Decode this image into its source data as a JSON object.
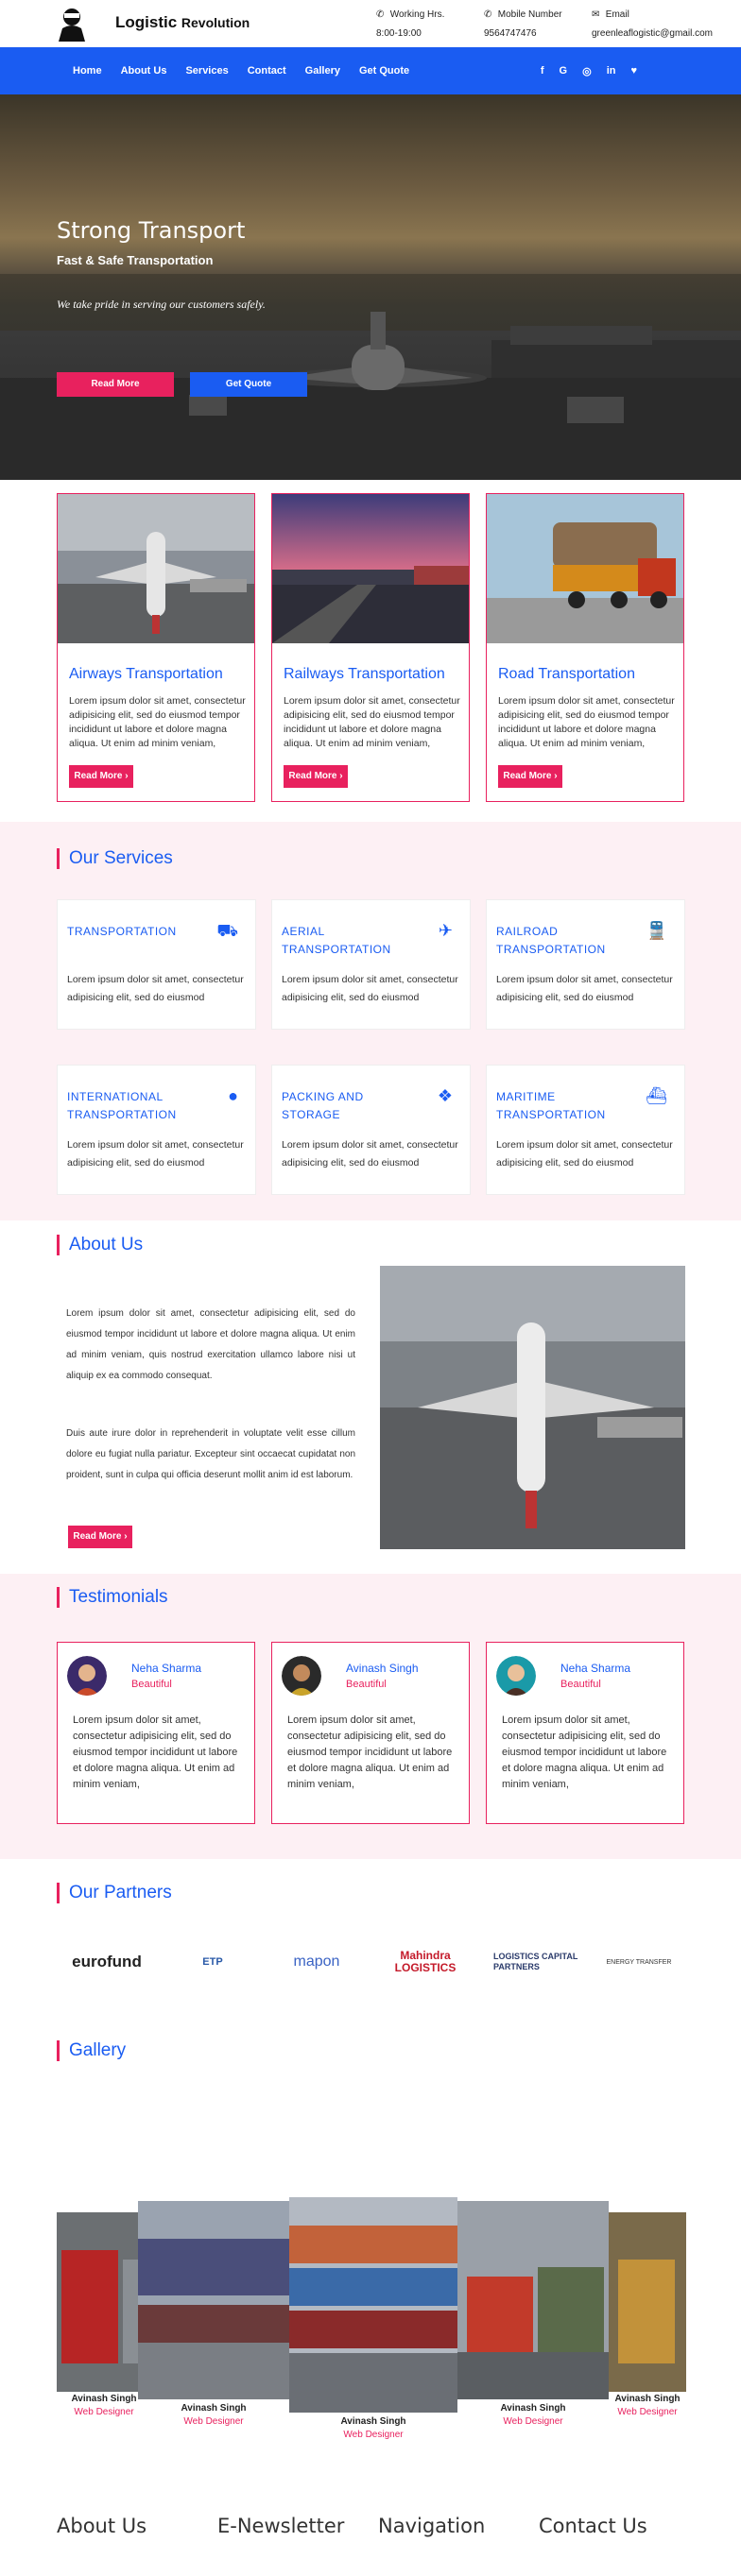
{
  "header": {
    "brand_main": "Logistic",
    "brand_sub": "Revolution",
    "working_label": "Working Hrs.",
    "working_value": "8:00-19:00",
    "mobile_label": "Mobile Number",
    "mobile_value": "9564747476",
    "email_label": "Email",
    "email_value": "greenleaflogistic@gmail.com"
  },
  "nav": {
    "items": [
      "Home",
      "About Us",
      "Services",
      "Contact",
      "Gallery",
      "Get Quote"
    ],
    "social": [
      "f",
      "G",
      "◎",
      "in",
      "♥"
    ]
  },
  "hero": {
    "title": "Strong Transport",
    "subtitle": "Fast & Safe Transportation",
    "tagline": "We take pride in serving our customers safely.",
    "btn_read": "Read More",
    "btn_quote": "Get Quote"
  },
  "transport": [
    {
      "title": "Airways Transportation",
      "text": "Lorem ipsum dolor sit amet, consectetur adipisicing elit, sed do eiusmod tempor incididunt ut labore et dolore magna aliqua. Ut enim ad minim veniam,",
      "btn": "Read More"
    },
    {
      "title": "Railways Transportation",
      "text": "Lorem ipsum dolor sit amet, consectetur adipisicing elit, sed do eiusmod tempor incididunt ut labore et dolore magna aliqua. Ut enim ad minim veniam,",
      "btn": "Read More"
    },
    {
      "title": "Road Transportation",
      "text": "Lorem ipsum dolor sit amet, consectetur adipisicing elit, sed do eiusmod tempor incididunt ut labore et dolore magna aliqua. Ut enim ad minim veniam,",
      "btn": "Read More"
    }
  ],
  "services": {
    "title": "Our Services",
    "items": [
      {
        "title": "TRANSPORTATION",
        "icon": "truck-icon",
        "text": "Lorem ipsum dolor sit amet, consectetur adipisicing elit, sed do eiusmod"
      },
      {
        "title": "AERIAL TRANSPORTATION",
        "icon": "plane-icon",
        "text": "Lorem ipsum dolor sit amet, consectetur adipisicing elit, sed do eiusmod"
      },
      {
        "title": "RAILROAD TRANSPORTATION",
        "icon": "train-icon",
        "text": "Lorem ipsum dolor sit amet, consectetur adipisicing elit, sed do eiusmod"
      },
      {
        "title": "INTERNATIONAL TRANSPORTATION",
        "icon": "globe-icon",
        "text": "Lorem ipsum dolor sit amet, consectetur adipisicing elit, sed do eiusmod"
      },
      {
        "title": "PACKING AND STORAGE",
        "icon": "dropbox-icon",
        "text": "Lorem ipsum dolor sit amet, consectetur adipisicing elit, sed do eiusmod"
      },
      {
        "title": "MARITIME TRANSPORTATION",
        "icon": "ship-icon",
        "text": "Lorem ipsum dolor sit amet, consectetur adipisicing elit, sed do eiusmod"
      }
    ]
  },
  "about": {
    "title": "About Us",
    "p1": "Lorem ipsum dolor sit amet, consectetur adipisicing elit, sed do eiusmod tempor incididunt ut labore et dolore magna aliqua. Ut enim ad minim veniam, quis nostrud exercitation ullamco labore nisi ut aliquip ex ea commodo consequat.",
    "p2": "Duis aute irure dolor in reprehenderit in voluptate velit esse cillum dolore eu fugiat nulla pariatur. Excepteur sint occaecat cupidatat non proident, sunt in culpa qui officia deserunt mollit anim id est laborum.",
    "btn": "Read More"
  },
  "testimonials": {
    "title": "Testimonials",
    "items": [
      {
        "name": "Neha Sharma",
        "role": "Beautiful",
        "text": "Lorem ipsum dolor sit amet, consectetur adipisicing elit, sed do eiusmod tempor incididunt ut labore et dolore magna aliqua. Ut enim ad minim veniam,"
      },
      {
        "name": "Avinash Singh",
        "role": "Beautiful",
        "text": "Lorem ipsum dolor sit amet, consectetur adipisicing elit, sed do eiusmod tempor incididunt ut labore et dolore magna aliqua. Ut enim ad minim veniam,"
      },
      {
        "name": "Neha Sharma",
        "role": "Beautiful",
        "text": "Lorem ipsum dolor sit amet, consectetur adipisicing elit, sed do eiusmod tempor incididunt ut labore et dolore magna aliqua. Ut enim ad minim veniam,"
      }
    ]
  },
  "partners": {
    "title": "Our Partners",
    "logos": [
      "eurofund",
      "ETP",
      "mapon",
      "Mahindra LOGISTICS",
      "LOGISTICS CAPITAL PARTNERS",
      "ENERGY TRANSFER"
    ]
  },
  "gallery": {
    "title": "Gallery",
    "items": [
      {
        "name": "Avinash Singh",
        "role": "Web Designer"
      },
      {
        "name": "Avinash Singh",
        "role": "Web Designer"
      },
      {
        "name": "Avinash Singh",
        "role": "Web Designer"
      },
      {
        "name": "Avinash Singh",
        "role": "Web Designer"
      },
      {
        "name": "Avinash Singh",
        "role": "Web Designer"
      }
    ]
  },
  "footer": {
    "cols": [
      "About Us",
      "E-Newsletter",
      "Navigation",
      "Contact Us"
    ]
  },
  "colors": {
    "primary": "#1a5cf2",
    "accent": "#e8215e",
    "tint": "#fdf0f4"
  }
}
